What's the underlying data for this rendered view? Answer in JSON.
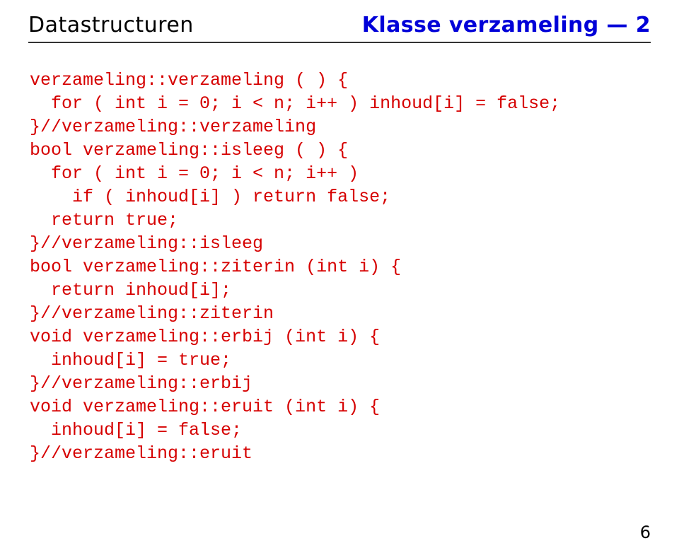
{
  "header": {
    "left": "Datastructuren",
    "right": "Klasse verzameling — 2"
  },
  "code": {
    "l1": "verzameling::verzameling ( ) {",
    "l2": "  for ( int i = 0; i < n; i++ ) inhoud[i] = false;",
    "l3": "}//verzameling::verzameling",
    "l4": "bool verzameling::isleeg ( ) {",
    "l5": "  for ( int i = 0; i < n; i++ )",
    "l6": "    if ( inhoud[i] ) return false;",
    "l7": "  return true;",
    "l8": "}//verzameling::isleeg",
    "l9": "bool verzameling::ziterin (int i) {",
    "l10": "  return inhoud[i];",
    "l11": "}//verzameling::ziterin",
    "l12": "void verzameling::erbij (int i) {",
    "l13": "  inhoud[i] = true;",
    "l14": "}//verzameling::erbij",
    "l15": "void verzameling::eruit (int i) {",
    "l16": "  inhoud[i] = false;",
    "l17": "}//verzameling::eruit"
  },
  "page_number": "6"
}
